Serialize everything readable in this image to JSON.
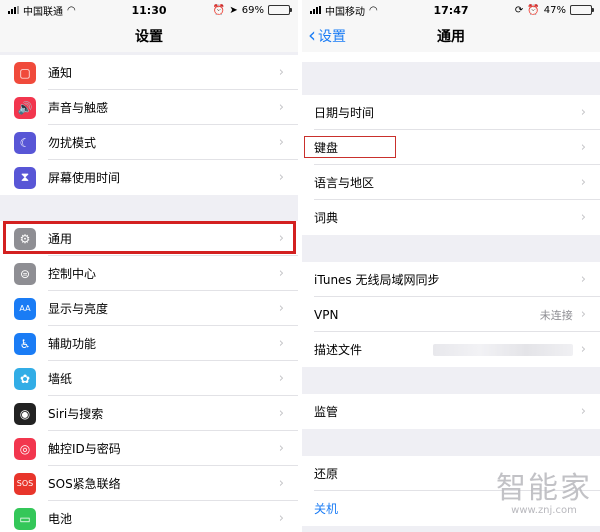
{
  "left": {
    "status": {
      "carrier": "中国联通",
      "time": "11:30",
      "battery": "69%"
    },
    "nav_title": "设置",
    "groups": [
      [
        {
          "label": "通知",
          "icon": "notification-icon",
          "color": "#f04a3b"
        },
        {
          "label": "声音与触感",
          "icon": "speaker-icon",
          "color": "#f2364e"
        },
        {
          "label": "勿扰模式",
          "icon": "moon-icon",
          "color": "#5856d6"
        },
        {
          "label": "屏幕使用时间",
          "icon": "hourglass-icon",
          "color": "#5856d6"
        }
      ],
      [
        {
          "label": "通用",
          "icon": "gear-icon",
          "color": "#8e8e93"
        },
        {
          "label": "控制中心",
          "icon": "switches-icon",
          "color": "#8e8e93"
        },
        {
          "label": "显示与亮度",
          "icon": "aa-icon",
          "color": "#1a7cf5"
        },
        {
          "label": "辅助功能",
          "icon": "accessibility-icon",
          "color": "#1a7cf5"
        },
        {
          "label": "墙纸",
          "icon": "flower-icon",
          "color": "#32ade6"
        },
        {
          "label": "Siri与搜索",
          "icon": "siri-icon",
          "color": "#222"
        },
        {
          "label": "触控ID与密码",
          "icon": "fingerprint-icon",
          "color": "#f2364e"
        },
        {
          "label": "SOS紧急联络",
          "icon": "sos-icon",
          "color": "#e8352b"
        },
        {
          "label": "电池",
          "icon": "battery-icon",
          "color": "#34c759"
        }
      ]
    ]
  },
  "right": {
    "status": {
      "carrier": "中国移动",
      "time": "17:47",
      "battery": "47%"
    },
    "back_label": "设置",
    "nav_title": "通用",
    "rows": {
      "datetime": "日期与时间",
      "keyboard": "键盘",
      "language": "语言与地区",
      "dictionary": "词典",
      "itunes": "iTunes 无线局域网同步",
      "vpn": "VPN",
      "vpn_value": "未连接",
      "profile": "描述文件",
      "supervision": "监管",
      "reset": "还原",
      "shutdown": "关机"
    }
  },
  "watermark": {
    "big": "智能家",
    "small": "www.znj.com"
  }
}
